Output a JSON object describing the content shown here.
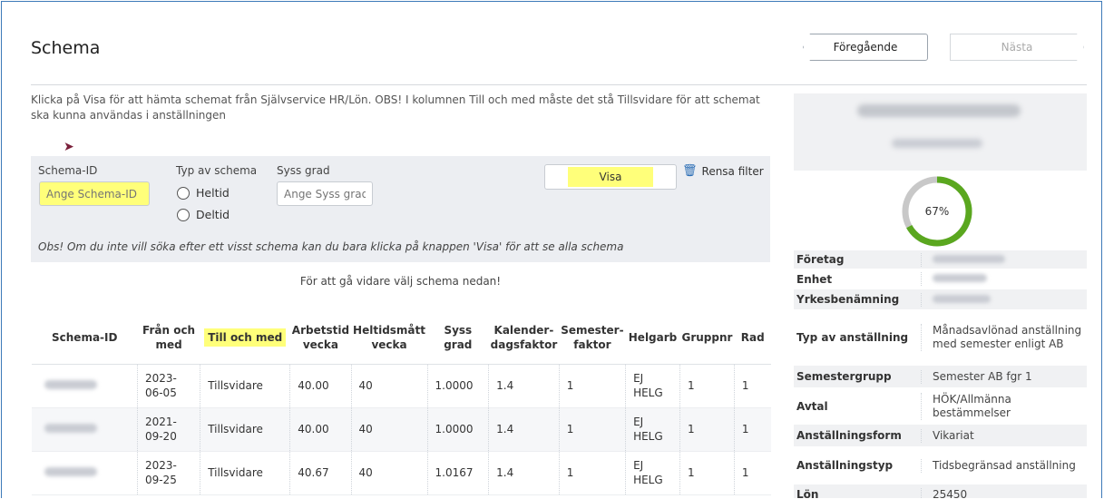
{
  "header": {
    "title": "Schema",
    "prev_label": "Föregående",
    "next_label": "Nästa"
  },
  "info_text": "Klicka på Visa för att hämta schemat från Självservice HR/Lön. OBS! I kolumnen Till och med måste det stå Tillsvidare för att schemat ska kunna användas i anställningen",
  "filter": {
    "schema_id_label": "Schema-ID",
    "schema_id_placeholder": "Ange Schema-ID",
    "schema_type_label": "Typ av schema",
    "radio_heltid": "Heltid",
    "radio_deltid": "Deltid",
    "syss_grad_label": "Syss grad",
    "syss_grad_placeholder": "Ange Syss grad",
    "visa_label": "Visa",
    "rensa_label": "Rensa filter",
    "obs_text": "Obs! Om du inte vill söka efter ett visst schema kan du bara klicka på knappen 'Visa' för att se alla schema"
  },
  "sub_hint": "För att gå vidare välj schema nedan!",
  "table": {
    "headers": [
      "Schema-ID",
      "Från och med",
      "Till och med",
      "Arbetstid vecka",
      "Heltidsmått vecka",
      "Syss grad",
      "Kalender-dagsfaktor",
      "Semester-faktor",
      "Helgarb",
      "Gruppnr",
      "Rad"
    ],
    "rows": [
      {
        "from": "2023-06-05",
        "to": "Tillsvidare",
        "arbetstid": "40.00",
        "heltid": "40",
        "syss": "1.0000",
        "kalender": "1.4",
        "semester": "1",
        "helgarb": "EJ HELG",
        "gruppnr": "1",
        "rad": "1"
      },
      {
        "from": "2021-09-20",
        "to": "Tillsvidare",
        "arbetstid": "40.00",
        "heltid": "40",
        "syss": "1.0000",
        "kalender": "1.4",
        "semester": "1",
        "helgarb": "EJ HELG",
        "gruppnr": "1",
        "rad": "1"
      },
      {
        "from": "2023-09-25",
        "to": "Tillsvidare",
        "arbetstid": "40.67",
        "heltid": "40",
        "syss": "1.0167",
        "kalender": "1.4",
        "semester": "1",
        "helgarb": "EJ HELG",
        "gruppnr": "1",
        "rad": "1"
      }
    ]
  },
  "side": {
    "progress_percent": 67,
    "progress_label": "67%",
    "progress_color": "#5aa71f",
    "track_color": "#c8c8c8",
    "fields": [
      {
        "key": "Företag",
        "value": ""
      },
      {
        "key": "Enhet",
        "value": ""
      },
      {
        "key": "Yrkesbenämning",
        "value": ""
      },
      {
        "key": "Typ av anställning",
        "value": "Månadsavlönad anställning med semester enligt AB"
      },
      {
        "key": "Semestergrupp",
        "value": "Semester AB fgr 1"
      },
      {
        "key": "Avtal",
        "value": "HÖK/Allmänna bestämmelser"
      },
      {
        "key": "Anställningsform",
        "value": "Vikariat"
      },
      {
        "key": "Anställningstyp",
        "value": "Tidsbegränsad anställning"
      },
      {
        "key": "Lön",
        "value": "25450"
      }
    ]
  },
  "colors": {
    "highlight": "#ffff7a",
    "accent_blue": "#2a6db5",
    "panel_bg": "#eceef2"
  }
}
